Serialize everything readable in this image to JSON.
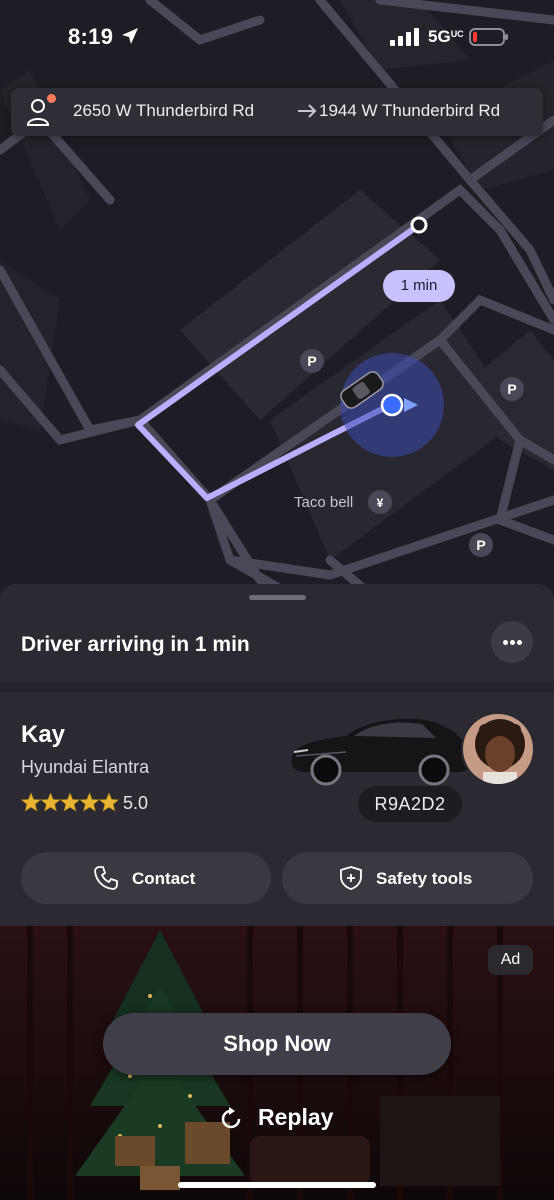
{
  "status_bar": {
    "time": "8:19",
    "network": "5G",
    "network_suffix": "UC",
    "battery_level": 0.15,
    "battery_color": "#ff3b30"
  },
  "route": {
    "from": "2650 W Thunderbird Rd",
    "to": "1944 W Thunderbird Rd",
    "icons": [
      "person-icon",
      "arrow-right-icon"
    ]
  },
  "map": {
    "eta_pill": "1 min",
    "poi": "Taco bell",
    "parking_label": "P",
    "route_color": "#b8b0ff",
    "location_color": "#3a6cff"
  },
  "sheet": {
    "title": "Driver arriving in 1 min",
    "driver": {
      "name": "Kay",
      "car": "Hyundai Elantra",
      "rating": "5.0",
      "stars": 5,
      "plate": "R9A2D2"
    },
    "actions": {
      "contact": "Contact",
      "safety": "Safety tools"
    }
  },
  "ad": {
    "badge": "Ad",
    "cta": "Shop Now",
    "replay": "Replay"
  }
}
